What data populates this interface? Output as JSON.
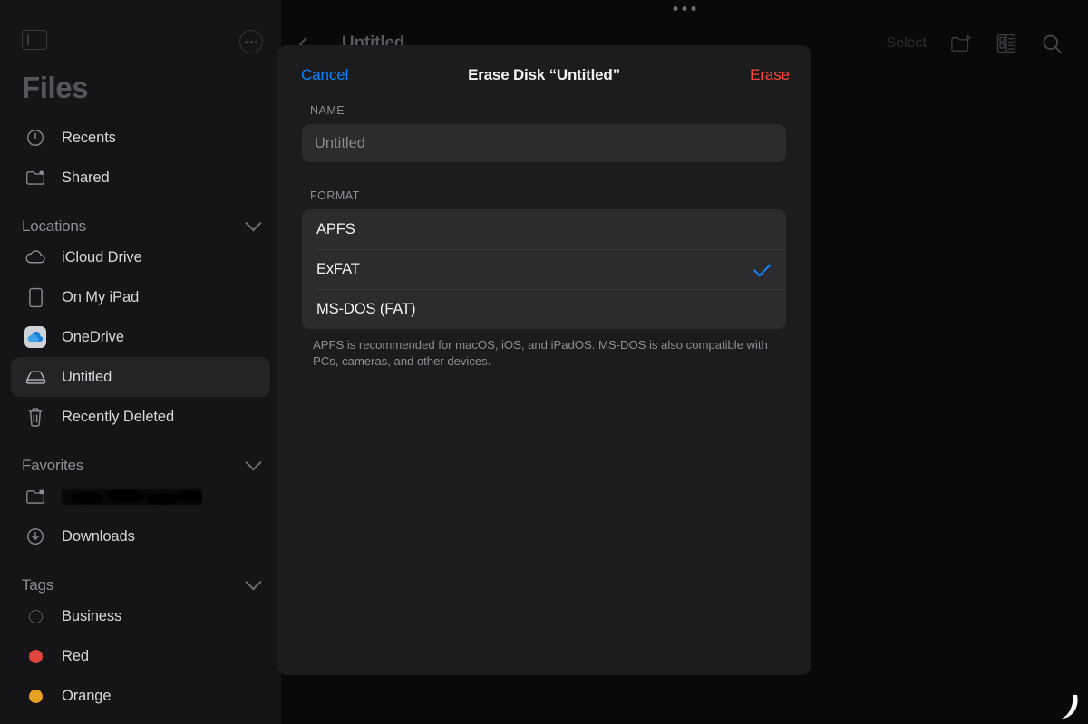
{
  "sidebar": {
    "toggle_icon": "sidebar-toggle-icon",
    "more_icon": "more-ellipsis-icon",
    "title": "Files",
    "top_items": [
      {
        "label": "Recents",
        "icon": "clock-icon"
      },
      {
        "label": "Shared",
        "icon": "shared-folder-icon"
      }
    ],
    "groups": [
      {
        "title": "Locations",
        "items": [
          {
            "label": "iCloud Drive",
            "icon": "icloud-icon",
            "selected": false
          },
          {
            "label": "On My iPad",
            "icon": "ipad-icon",
            "selected": false
          },
          {
            "label": "OneDrive",
            "icon": "onedrive-icon",
            "selected": false
          },
          {
            "label": "Untitled",
            "icon": "external-drive-icon",
            "selected": true
          },
          {
            "label": "Recently Deleted",
            "icon": "trash-icon",
            "selected": false
          }
        ]
      },
      {
        "title": "Favorites",
        "items": [
          {
            "label": "",
            "icon": "shared-folder-icon",
            "redacted": true,
            "selected": false
          },
          {
            "label": "Downloads",
            "icon": "download-icon",
            "selected": false
          }
        ]
      },
      {
        "title": "Tags",
        "items": [
          {
            "label": "Business",
            "icon": "tag-hollow-icon",
            "color": "none",
            "selected": false
          },
          {
            "label": "Red",
            "icon": "tag-dot-icon",
            "color": "#e0443e",
            "selected": false
          },
          {
            "label": "Orange",
            "icon": "tag-dot-icon",
            "color": "#e8a020",
            "selected": false
          }
        ]
      }
    ]
  },
  "toolbar": {
    "back_icon": "chevron-left-icon",
    "title": "Untitled",
    "select_label": "Select",
    "new_folder_icon": "new-folder-icon",
    "grid_view_icon": "grid-view-icon",
    "search_icon": "search-icon",
    "multitask_icon": "multitasking-dots-icon"
  },
  "modal": {
    "cancel_label": "Cancel",
    "title": "Erase Disk “Untitled”",
    "erase_label": "Erase",
    "name_section_header": "NAME",
    "name_placeholder": "Untitled",
    "name_value": "",
    "format_section_header": "FORMAT",
    "format_options": [
      {
        "label": "APFS",
        "selected": false
      },
      {
        "label": "ExFAT",
        "selected": true
      },
      {
        "label": "MS-DOS (FAT)",
        "selected": false
      }
    ],
    "footnote": "APFS is recommended for macOS, iOS, and iPadOS. MS-DOS is also compatible with PCs, cameras, and other devices."
  },
  "colors": {
    "accent_blue": "#0a84ff",
    "destructive_red": "#ff453a",
    "modal_bg": "#1c1c1e",
    "field_bg": "#2c2c2e",
    "sidebar_bg": "#151517"
  }
}
